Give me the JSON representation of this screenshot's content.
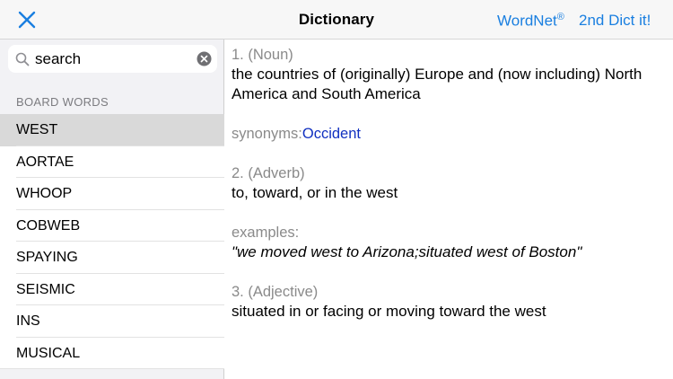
{
  "navbar": {
    "title": "Dictionary",
    "wordnet_label": "WordNet",
    "wordnet_mark": "®",
    "second_dict_label": "2nd Dict it!",
    "accent_color": "#1a7fe0"
  },
  "sidebar": {
    "search_value": "search",
    "section_header": "BOARD WORDS",
    "words": [
      "WEST",
      "AORTAE",
      "WHOOP",
      "COBWEB",
      "SPAYING",
      "SEISMIC",
      "INS",
      "MUSICAL"
    ],
    "selected_word": "WEST"
  },
  "definition": {
    "senses": [
      {
        "pos": "1. (Noun)",
        "gloss": "the countries of (originally) Europe and (now including) North America and South America",
        "synonyms_label": "synonyms:",
        "synonym": "Occident"
      },
      {
        "pos": "2. (Adverb)",
        "gloss": "to, toward, or in the west",
        "examples_label": "examples:",
        "example": "\"we moved west to Arizona;situated west of Boston\""
      },
      {
        "pos": "3. (Adjective)",
        "gloss": "situated in or facing or moving toward the west"
      }
    ]
  },
  "icons": {
    "close": "close-icon",
    "search": "search-icon",
    "clear": "clear-icon"
  }
}
